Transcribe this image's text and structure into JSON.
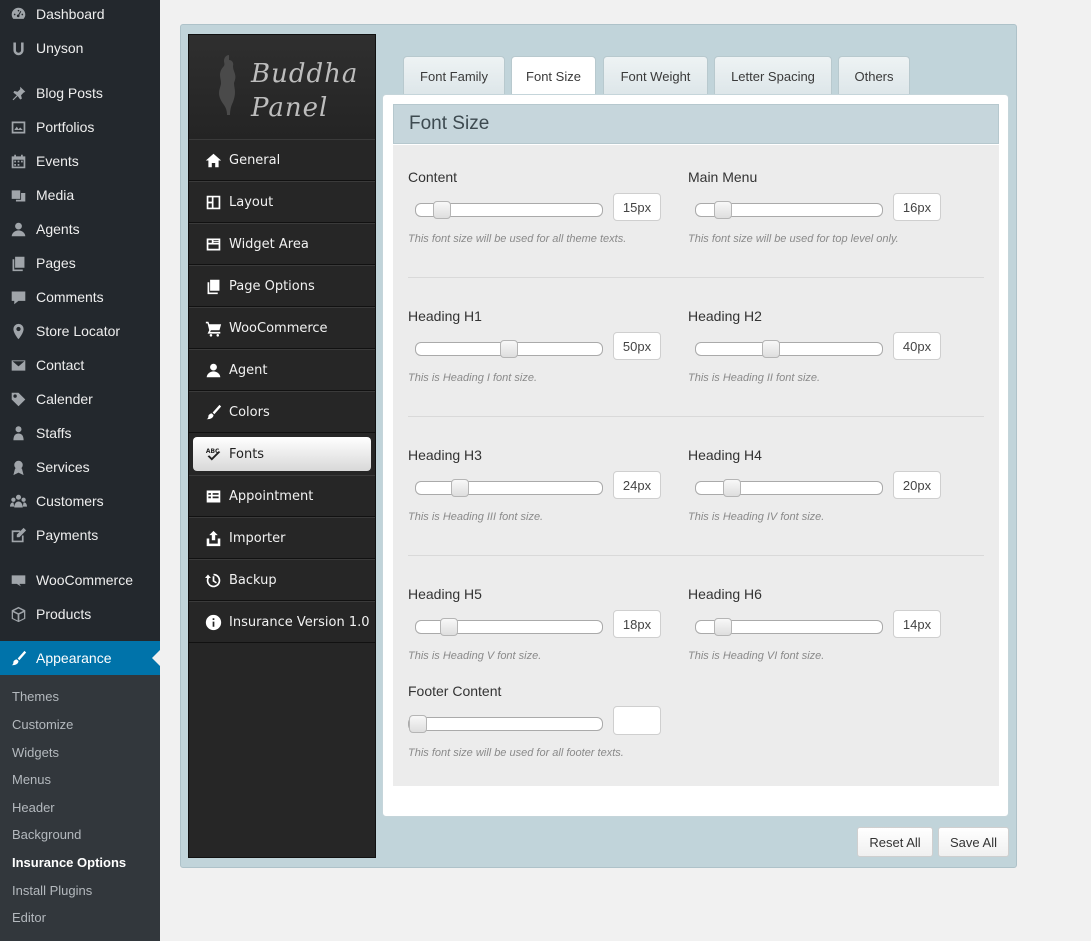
{
  "wp_menu": {
    "items": [
      {
        "label": "Dashboard",
        "icon": "dashboard-icon"
      },
      {
        "label": "Unyson",
        "icon": "unyson-icon"
      },
      {
        "label": "Blog Posts",
        "icon": "pin-icon"
      },
      {
        "label": "Portfolios",
        "icon": "portfolio-icon"
      },
      {
        "label": "Events",
        "icon": "calendar-icon"
      },
      {
        "label": "Media",
        "icon": "media-icon"
      },
      {
        "label": "Agents",
        "icon": "user-icon"
      },
      {
        "label": "Pages",
        "icon": "pages-icon"
      },
      {
        "label": "Comments",
        "icon": "comment-icon"
      },
      {
        "label": "Store Locator",
        "icon": "location-icon"
      },
      {
        "label": "Contact",
        "icon": "mail-icon"
      },
      {
        "label": "Calender",
        "icon": "tag-icon"
      },
      {
        "label": "Staffs",
        "icon": "staff-icon"
      },
      {
        "label": "Services",
        "icon": "award-icon"
      },
      {
        "label": "Customers",
        "icon": "groups-icon"
      },
      {
        "label": "Payments",
        "icon": "edit-icon"
      },
      {
        "label": "WooCommerce",
        "icon": "woo-icon"
      },
      {
        "label": "Products",
        "icon": "cube-icon"
      },
      {
        "label": "Appearance",
        "icon": "brush-icon"
      }
    ],
    "submenu": [
      "Themes",
      "Customize",
      "Widgets",
      "Menus",
      "Header",
      "Background",
      "Insurance Options",
      "Install Plugins",
      "Editor"
    ]
  },
  "panel_nav": {
    "logo_line1": "Buddha",
    "logo_line2": "Panel",
    "items": [
      {
        "label": "General",
        "icon": "home-icon"
      },
      {
        "label": "Layout",
        "icon": "layout-icon"
      },
      {
        "label": "Widget Area",
        "icon": "widget-icon"
      },
      {
        "label": "Page Options",
        "icon": "pages-icon"
      },
      {
        "label": "WooCommerce",
        "icon": "cart-icon"
      },
      {
        "label": "Agent",
        "icon": "user-icon"
      },
      {
        "label": "Colors",
        "icon": "brush-icon"
      },
      {
        "label": "Fonts",
        "icon": "spellcheck-icon"
      },
      {
        "label": "Appointment",
        "icon": "form-icon"
      },
      {
        "label": "Importer",
        "icon": "upload-icon"
      },
      {
        "label": "Backup",
        "icon": "history-icon"
      },
      {
        "label": "Insurance Version 1.0",
        "icon": "info-icon"
      }
    ]
  },
  "tabs": [
    "Font Family",
    "Font Size",
    "Font Weight",
    "Letter Spacing",
    "Others"
  ],
  "section_title": "Font Size",
  "fields": [
    {
      "label": "Content",
      "value": "15px",
      "help": "This font size will be used for all theme texts.",
      "level": 0.1
    },
    {
      "label": "Main Menu",
      "value": "16px",
      "help": "This font size will be used for top level only.",
      "level": 0.11
    },
    {
      "label": "Heading H1",
      "value": "50px",
      "help": "This is Heading I font size.",
      "level": 0.5
    },
    {
      "label": "Heading H2",
      "value": "40px",
      "help": "This is Heading II font size.",
      "level": 0.39
    },
    {
      "label": "Heading H3",
      "value": "24px",
      "help": "This is Heading III font size.",
      "level": 0.21
    },
    {
      "label": "Heading H4",
      "value": "20px",
      "help": "This is Heading IV font size.",
      "level": 0.16
    },
    {
      "label": "Heading H5",
      "value": "18px",
      "help": "This is Heading V font size.",
      "level": 0.14
    },
    {
      "label": "Heading H6",
      "value": "14px",
      "help": "This is Heading VI font size.",
      "level": 0.11
    },
    {
      "label": "Footer Content",
      "value": "",
      "help": "This font size will be used for all footer texts.",
      "level": 0.0
    }
  ],
  "buttons": {
    "reset": "Reset All",
    "save": "Save All"
  },
  "colors": {
    "wp_active": "#0073aa",
    "panel_bg": "#c1d4da",
    "nav_bg": "#262626"
  }
}
